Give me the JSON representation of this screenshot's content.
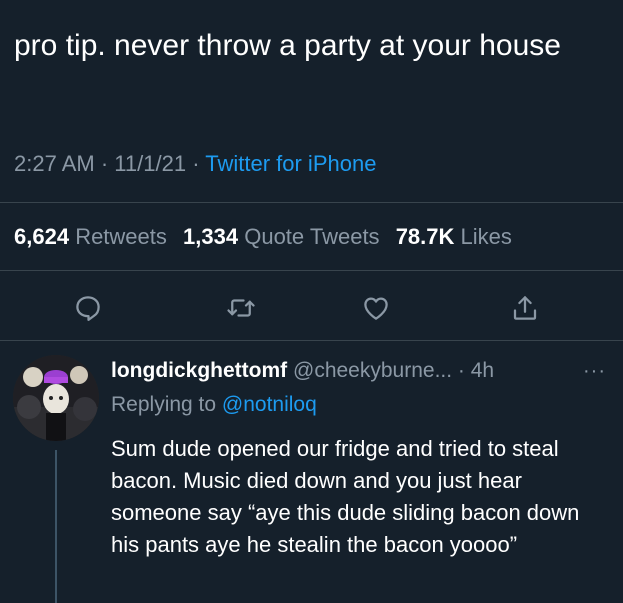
{
  "tweet": {
    "text": "pro tip. never throw a party at your house",
    "time": "2:27 AM",
    "date": "11/1/21",
    "source": "Twitter for iPhone"
  },
  "stats": {
    "retweets_count": "6,624",
    "retweets_label": "Retweets",
    "quotes_count": "1,334",
    "quotes_label": "Quote Tweets",
    "likes_count": "78.7K",
    "likes_label": "Likes"
  },
  "actions": {
    "icons": [
      "reply-icon",
      "retweet-icon",
      "like-icon",
      "share-icon"
    ],
    "color": "#8b98a5"
  },
  "reply": {
    "display_name": "longdickghettomf",
    "handle": "@cheekyburne...",
    "time": "4h",
    "more": "···",
    "replying_prefix": "Replying to",
    "replying_handle": "@notniloq",
    "text": "Sum dude opened our fridge and tried to steal bacon. Music died down and you just hear someone say “aye this dude sliding bacon down his pants aye he stealin the bacon yoooo”"
  },
  "colors": {
    "background": "#15202b",
    "text": "#ffffff",
    "secondary": "#8b98a5",
    "accent": "#1d9bf0",
    "divider": "#38444d"
  }
}
